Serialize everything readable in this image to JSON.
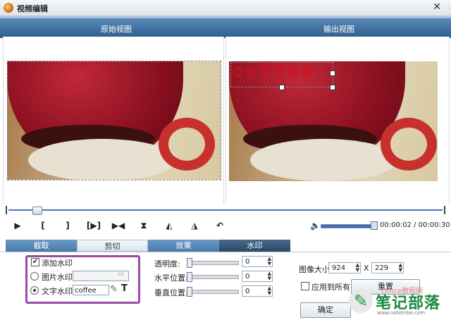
{
  "window": {
    "title": "视频编辑",
    "close_glyph": "✕"
  },
  "views": {
    "original_label": "原始视图",
    "output_label": "输出视图"
  },
  "watermark_preview_text": "coffee",
  "playback": {
    "buttons": [
      "▶",
      "[",
      "]",
      "[▶]",
      "▶◀",
      "⧗",
      "◭",
      "◮",
      "↶"
    ],
    "time_current": "00:00:02",
    "time_total": "00:00:30",
    "time_separator": " / "
  },
  "tabs": [
    "截取",
    "剪切",
    "效果",
    "水印"
  ],
  "watermark": {
    "add_label": "添加水印",
    "add_checked": "✔",
    "image_label": "图片水印:",
    "image_value": "",
    "text_label": "文字水印:",
    "text_value": "coffee",
    "text_tool_glyph": "T",
    "pen_glyph": "✎"
  },
  "adjust": {
    "opacity_label": "透明度:",
    "opacity_value": "0",
    "hpos_label": "水平位置:",
    "hpos_value": "0",
    "vpos_label": "垂直位置:",
    "vpos_value": "0"
  },
  "image_size": {
    "label": "图像大小:",
    "width": "924",
    "x": "X",
    "height": "229",
    "apply_all_label": "应用到所有",
    "reset_label": "重置",
    "ok_label": "确定"
  },
  "brand": {
    "name": "笔记部落",
    "url": "www.notetribe.com",
    "overlay": "Office教程网"
  },
  "colors": {
    "header_blue": "#2d5e8e",
    "tab_dark": "#2a4868",
    "highlight_purple": "#9a4aa8",
    "watermark_red": "#d01020"
  }
}
